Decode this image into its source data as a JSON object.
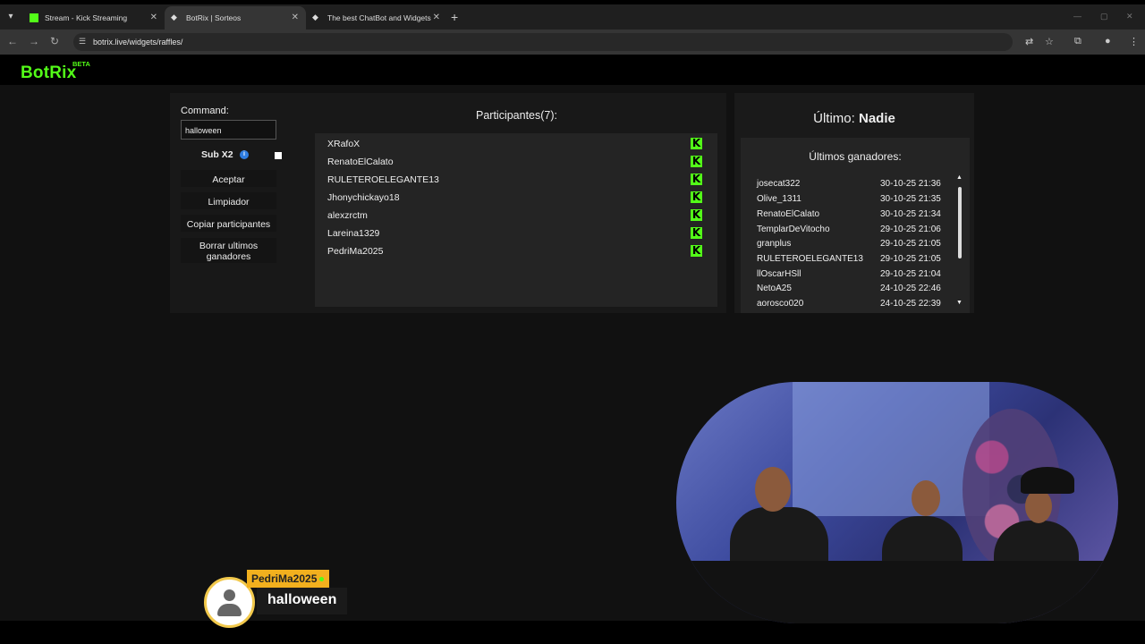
{
  "browser": {
    "tabs": [
      {
        "title": "Stream - Kick Streaming",
        "favicon": "kick-icon",
        "active": false
      },
      {
        "title": "BotRix | Sorteos",
        "favicon": "diamond-icon",
        "active": true
      },
      {
        "title": "The best ChatBot and Widgets",
        "favicon": "diamond-icon",
        "active": false
      }
    ],
    "url": "botrix.live/widgets/raffles/"
  },
  "header": {
    "logo": "BotRix",
    "badge": "BETA",
    "accent": "#53fc18"
  },
  "left": {
    "command_label": "Command:",
    "command_value": "halloween",
    "sub_label": "Sub X2",
    "sub_checked": false,
    "buttons": {
      "accept": "Aceptar",
      "clear": "Limpiador",
      "copy": "Copiar participantes",
      "delete_line1": "Borrar ultimos",
      "delete_line2": "ganadores"
    }
  },
  "participants": {
    "title": "Participantes(7):",
    "list": [
      "XRafoX",
      "RenatoElCalato",
      "RULETEROELEGANTE13",
      "Jhonychickayo18",
      "alexzrctm",
      "Lareina1329",
      "PedriMa2025"
    ]
  },
  "last": {
    "label": "Último:",
    "value": "Nadie"
  },
  "winners": {
    "title": "Últimos ganadores:",
    "list": [
      {
        "name": "josecat322",
        "date": "30-10-25 21:36"
      },
      {
        "name": "Olive_1311",
        "date": "30-10-25 21:35"
      },
      {
        "name": "RenatoElCalato",
        "date": "30-10-25 21:34"
      },
      {
        "name": "TemplarDeVitocho",
        "date": "29-10-25 21:06"
      },
      {
        "name": "granplus",
        "date": "29-10-25 21:05"
      },
      {
        "name": "RULETEROELEGANTE13",
        "date": "29-10-25 21:05"
      },
      {
        "name": "llOscarHSll",
        "date": "29-10-25 21:04"
      },
      {
        "name": "NetoA25",
        "date": "24-10-25 22:46"
      },
      {
        "name": "aorosco020",
        "date": "24-10-25 22:39"
      }
    ]
  },
  "overlay": {
    "username": "PedriMa2025",
    "message": "halloween"
  }
}
